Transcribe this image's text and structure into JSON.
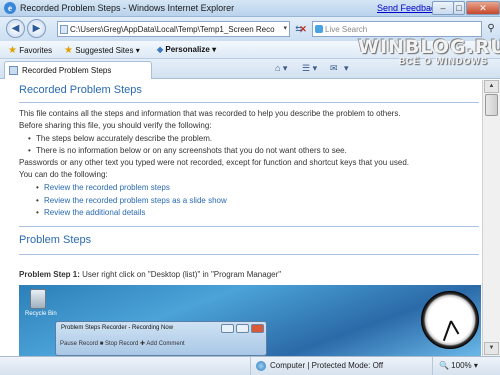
{
  "window": {
    "title": "Recorded Problem Steps - Windows Internet Explorer",
    "send_feedback": "Send Feedback",
    "minimize": "–",
    "maximize": "□",
    "close": "✕"
  },
  "address": {
    "back": "◀",
    "forward": "▶",
    "url": "C:\\Users\\Greg\\AppData\\Local\\Temp\\Temp1_Screen Reco",
    "go": "⇆",
    "stop": "✕",
    "refresh": "↻"
  },
  "search": {
    "placeholder": "Live Search",
    "button": "⚲"
  },
  "favorites": {
    "favorites_label": "Favorites",
    "suggested_label": "Suggested Sites ▾",
    "personalize_label": "Personalize ▾"
  },
  "tab": {
    "label": "Recorded Problem Steps"
  },
  "tab_tools": [
    "⌂ ▾",
    "☰ ▾",
    "✉",
    "▾"
  ],
  "watermark": {
    "line1": "WINBLOG.RU",
    "line2": "ВСЁ О WINDOWS"
  },
  "page": {
    "heading": "Recorded Problem Steps",
    "intro1": "This file contains all the steps and information that was recorded to help you describe the problem to others.",
    "intro2": "Before sharing this file, you should verify the following:",
    "bullets": [
      "The steps below accurately describe the problem.",
      "There is no information below or on any screenshots that you do not want others to see."
    ],
    "note": "Passwords or any other text you typed were not recorded, except for function and shortcut keys that you used.",
    "can_do": "You can do the following:",
    "links": [
      "Review the recorded problem steps",
      "Review the recorded problem steps as a slide show",
      "Review the additional details"
    ],
    "section_heading": "Problem Steps",
    "step_label": "Problem Step 1:",
    "step_text": " User right click on \"Desktop (list)\" in \"Program Manager\""
  },
  "screenshot": {
    "recycle_bin": "Recycle Bin",
    "recorder_title": "Problem Steps Recorder - Recording Now",
    "recorder_tools": "Pause Record   ■ Stop Record   ✚ Add Comment"
  },
  "status": {
    "zone": "Computer | Protected Mode: Off",
    "zoom": "🔍 100% ▾"
  }
}
